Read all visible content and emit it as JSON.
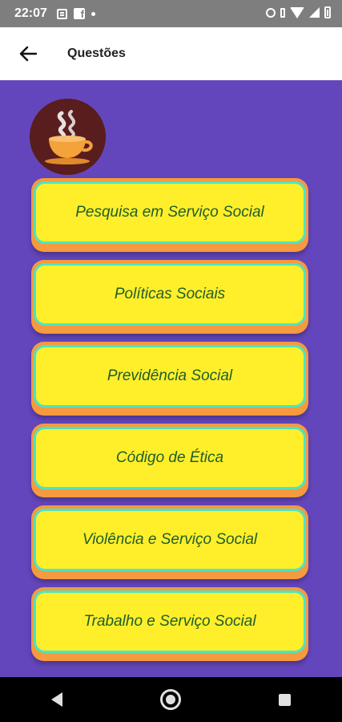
{
  "status_bar": {
    "time": "22:07",
    "left_icons": [
      "news-icon",
      "facebook-icon",
      "dot-icon"
    ],
    "right_icons": [
      "alarm-icon",
      "vibrate-icon",
      "wifi-icon",
      "signal-icon",
      "battery-icon"
    ]
  },
  "app_bar": {
    "title": "Questões",
    "back_icon": "arrow-left-icon"
  },
  "colors": {
    "content_background": "#6446bc",
    "button_outer": "#f59a3e",
    "button_inner": "#ffef2b",
    "button_border": "#4fe3c2",
    "button_text": "#1f5d2b",
    "avatar_background": "#5a1d1d"
  },
  "avatar": {
    "icon": "coffee-cup-icon"
  },
  "menu": {
    "items": [
      {
        "label": "Pesquisa em Serviço Social"
      },
      {
        "label": "Políticas Sociais"
      },
      {
        "label": "Previdência Social"
      },
      {
        "label": "Código de Ética"
      },
      {
        "label": "Violência e Serviço Social"
      },
      {
        "label": "Trabalho e Serviço Social"
      }
    ]
  },
  "nav_bar": {
    "buttons": [
      "back-triangle-icon",
      "home-circle-icon",
      "recents-square-icon"
    ]
  }
}
